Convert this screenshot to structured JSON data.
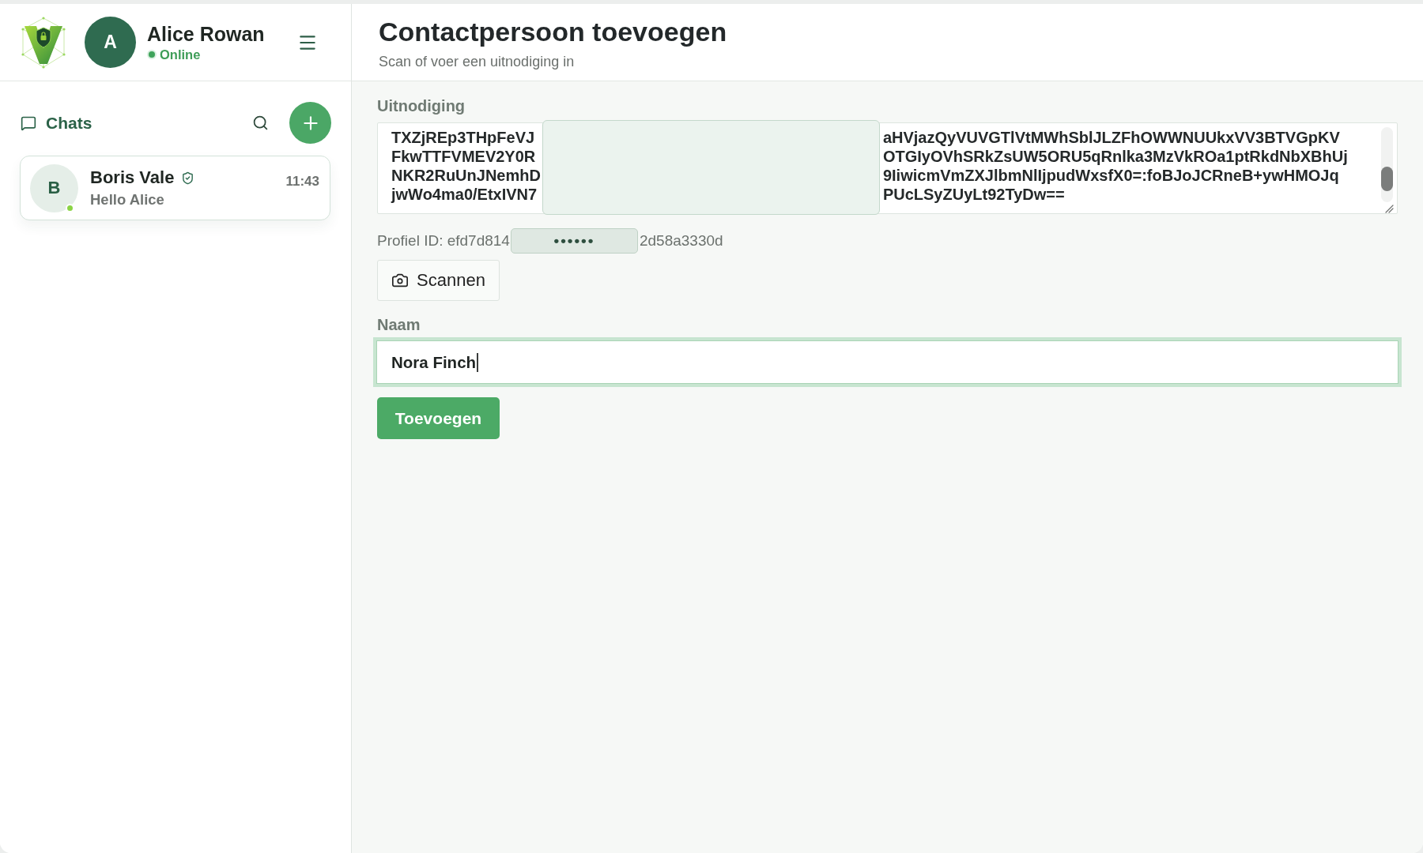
{
  "sidebar": {
    "user": {
      "initial": "A",
      "name": "Alice Rowan",
      "status": "Online"
    },
    "section": {
      "title": "Chats"
    },
    "chats": [
      {
        "initial": "B",
        "name": "Boris Vale",
        "verified": true,
        "online": true,
        "preview": "Hello Alice",
        "time": "11:43",
        "selected": false
      }
    ]
  },
  "main": {
    "title": "Contactpersoon toevoegen",
    "subtitle": "Scan of voer een uitnodiging in",
    "invitation": {
      "label": "Uitnodiging",
      "lines": [
        {
          "start": "TXZjREp3THpFeVJ",
          "end": "aHVjazQyVUVGTlVtMWhSblJLZFhOWWNUUkxVV3BTVGpKV"
        },
        {
          "start": "FkwTTFVMEV2Y0R",
          "end": "OTGIyOVhSRkZsUW5ORU5qRnlka3MzVkROa1ptRkdNbXBhUj"
        },
        {
          "start": "NKR2RuUnJNemhD",
          "end": "9IiwicmVmZXJlbmNlIjpudWxsfX0=:foBJoJCRneB+ywHMOJq"
        },
        {
          "start": "jwWo4ma0/EtxIVN7",
          "end": "PUcLSyZUyLt92TyDw=="
        }
      ]
    },
    "profile_id": {
      "text_before": "Profiel ID: efd7d814",
      "masked": "••••••",
      "text_after": "2d58a3330d"
    },
    "scan_button": "Scannen",
    "name_field": {
      "label": "Naam",
      "value": "Nora Finch",
      "focused": true
    },
    "submit_button": "Toevoegen"
  }
}
